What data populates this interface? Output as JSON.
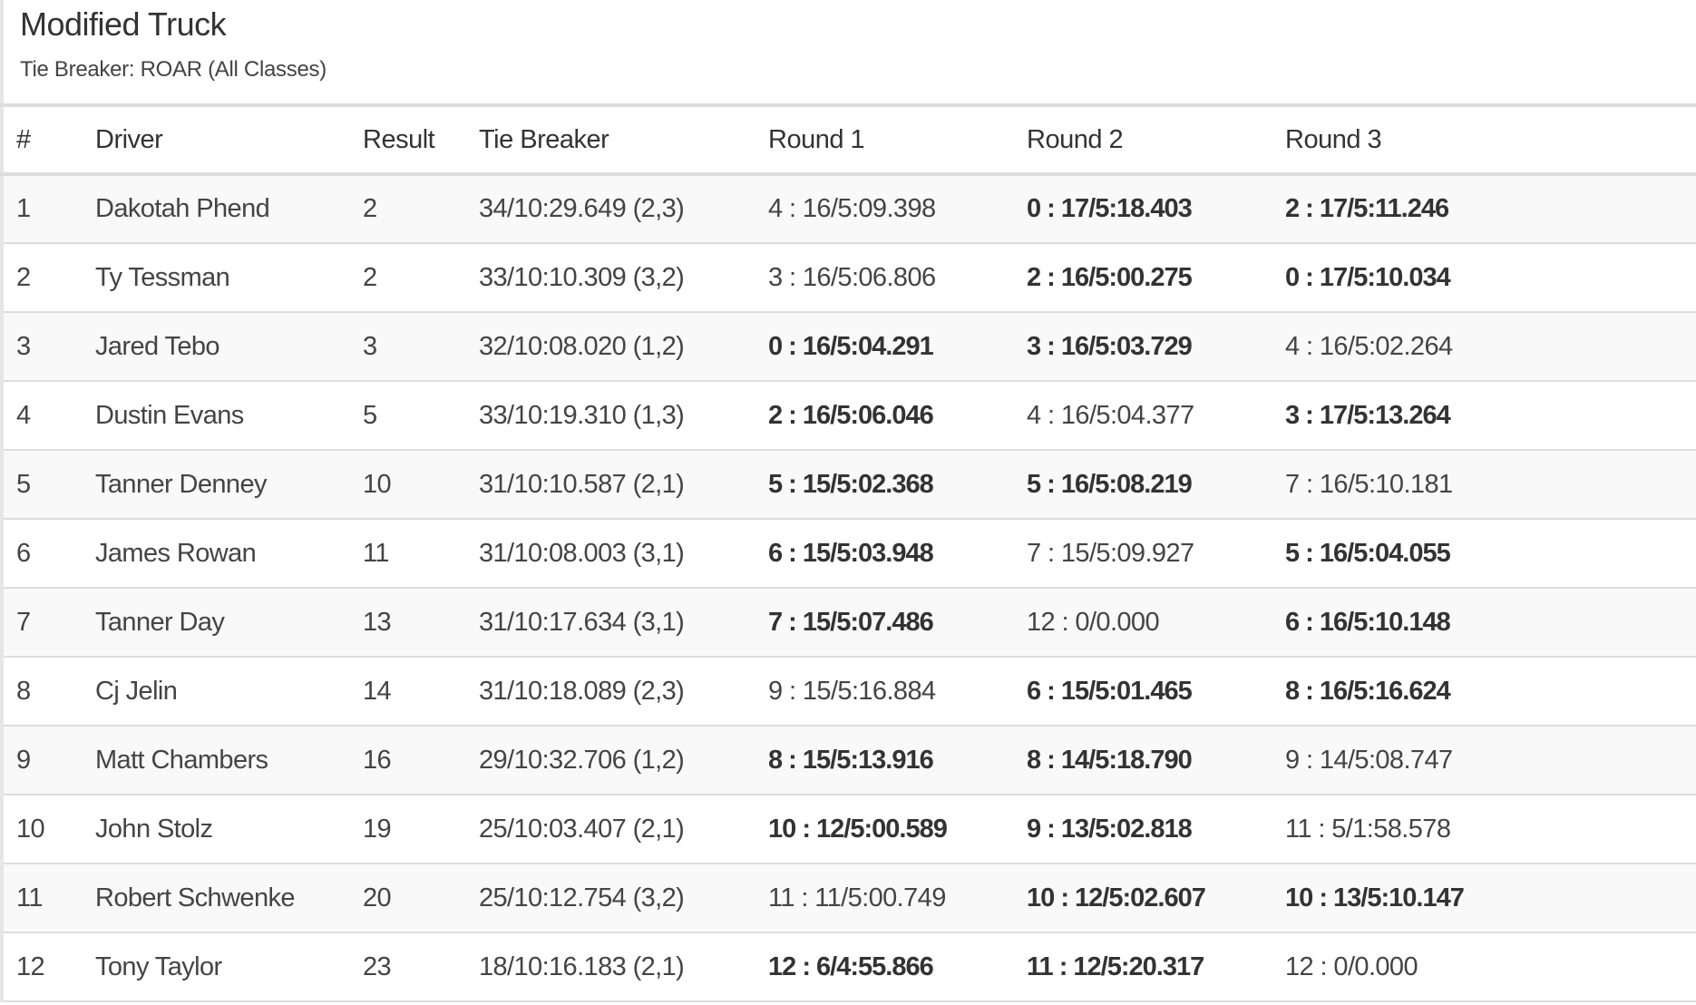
{
  "header": {
    "title": "Modified Truck",
    "subtitle": "Tie Breaker: ROAR (All Classes)"
  },
  "table": {
    "columns": [
      "#",
      "Driver",
      "Result",
      "Tie Breaker",
      "Round 1",
      "Round 2",
      "Round 3"
    ],
    "rows": [
      {
        "num": "1",
        "driver": "Dakotah Phend",
        "result": "2",
        "tiebreaker": "34/10:29.649 (2,3)",
        "r1": "4 : 16/5:09.398",
        "r1_bold": false,
        "r2": "0 : 17/5:18.403",
        "r2_bold": true,
        "r3": "2 : 17/5:11.246",
        "r3_bold": true
      },
      {
        "num": "2",
        "driver": "Ty Tessman",
        "result": "2",
        "tiebreaker": "33/10:10.309 (3,2)",
        "r1": "3 : 16/5:06.806",
        "r1_bold": false,
        "r2": "2 : 16/5:00.275",
        "r2_bold": true,
        "r3": "0 : 17/5:10.034",
        "r3_bold": true
      },
      {
        "num": "3",
        "driver": "Jared Tebo",
        "result": "3",
        "tiebreaker": "32/10:08.020 (1,2)",
        "r1": "0 : 16/5:04.291",
        "r1_bold": true,
        "r2": "3 : 16/5:03.729",
        "r2_bold": true,
        "r3": "4 : 16/5:02.264",
        "r3_bold": false
      },
      {
        "num": "4",
        "driver": "Dustin Evans",
        "result": "5",
        "tiebreaker": "33/10:19.310 (1,3)",
        "r1": "2 : 16/5:06.046",
        "r1_bold": true,
        "r2": "4 : 16/5:04.377",
        "r2_bold": false,
        "r3": "3 : 17/5:13.264",
        "r3_bold": true
      },
      {
        "num": "5",
        "driver": "Tanner Denney",
        "result": "10",
        "tiebreaker": "31/10:10.587 (2,1)",
        "r1": "5 : 15/5:02.368",
        "r1_bold": true,
        "r2": "5 : 16/5:08.219",
        "r2_bold": true,
        "r3": "7 : 16/5:10.181",
        "r3_bold": false
      },
      {
        "num": "6",
        "driver": "James Rowan",
        "result": "11",
        "tiebreaker": "31/10:08.003 (3,1)",
        "r1": "6 : 15/5:03.948",
        "r1_bold": true,
        "r2": "7 : 15/5:09.927",
        "r2_bold": false,
        "r3": "5 : 16/5:04.055",
        "r3_bold": true
      },
      {
        "num": "7",
        "driver": "Tanner Day",
        "result": "13",
        "tiebreaker": "31/10:17.634 (3,1)",
        "r1": "7 : 15/5:07.486",
        "r1_bold": true,
        "r2": "12 : 0/0.000",
        "r2_bold": false,
        "r3": "6 : 16/5:10.148",
        "r3_bold": true
      },
      {
        "num": "8",
        "driver": "Cj Jelin",
        "result": "14",
        "tiebreaker": "31/10:18.089 (2,3)",
        "r1": "9 : 15/5:16.884",
        "r1_bold": false,
        "r2": "6 : 15/5:01.465",
        "r2_bold": true,
        "r3": "8 : 16/5:16.624",
        "r3_bold": true
      },
      {
        "num": "9",
        "driver": "Matt Chambers",
        "result": "16",
        "tiebreaker": "29/10:32.706 (1,2)",
        "r1": "8 : 15/5:13.916",
        "r1_bold": true,
        "r2": "8 : 14/5:18.790",
        "r2_bold": true,
        "r3": "9 : 14/5:08.747",
        "r3_bold": false
      },
      {
        "num": "10",
        "driver": "John Stolz",
        "result": "19",
        "tiebreaker": "25/10:03.407 (2,1)",
        "r1": "10 : 12/5:00.589",
        "r1_bold": true,
        "r2": "9 : 13/5:02.818",
        "r2_bold": true,
        "r3": "11 : 5/1:58.578",
        "r3_bold": false
      },
      {
        "num": "11",
        "driver": "Robert Schwenke",
        "result": "20",
        "tiebreaker": "25/10:12.754 (3,2)",
        "r1": "11 : 11/5:00.749",
        "r1_bold": false,
        "r2": "10 : 12/5:02.607",
        "r2_bold": true,
        "r3": "10 : 13/5:10.147",
        "r3_bold": true
      },
      {
        "num": "12",
        "driver": "Tony Taylor",
        "result": "23",
        "tiebreaker": "18/10:16.183 (2,1)",
        "r1": "12 : 6/4:55.866",
        "r1_bold": true,
        "r2": "11 : 12/5:20.317",
        "r2_bold": true,
        "r3": "12 : 0/0.000",
        "r3_bold": false
      }
    ]
  }
}
